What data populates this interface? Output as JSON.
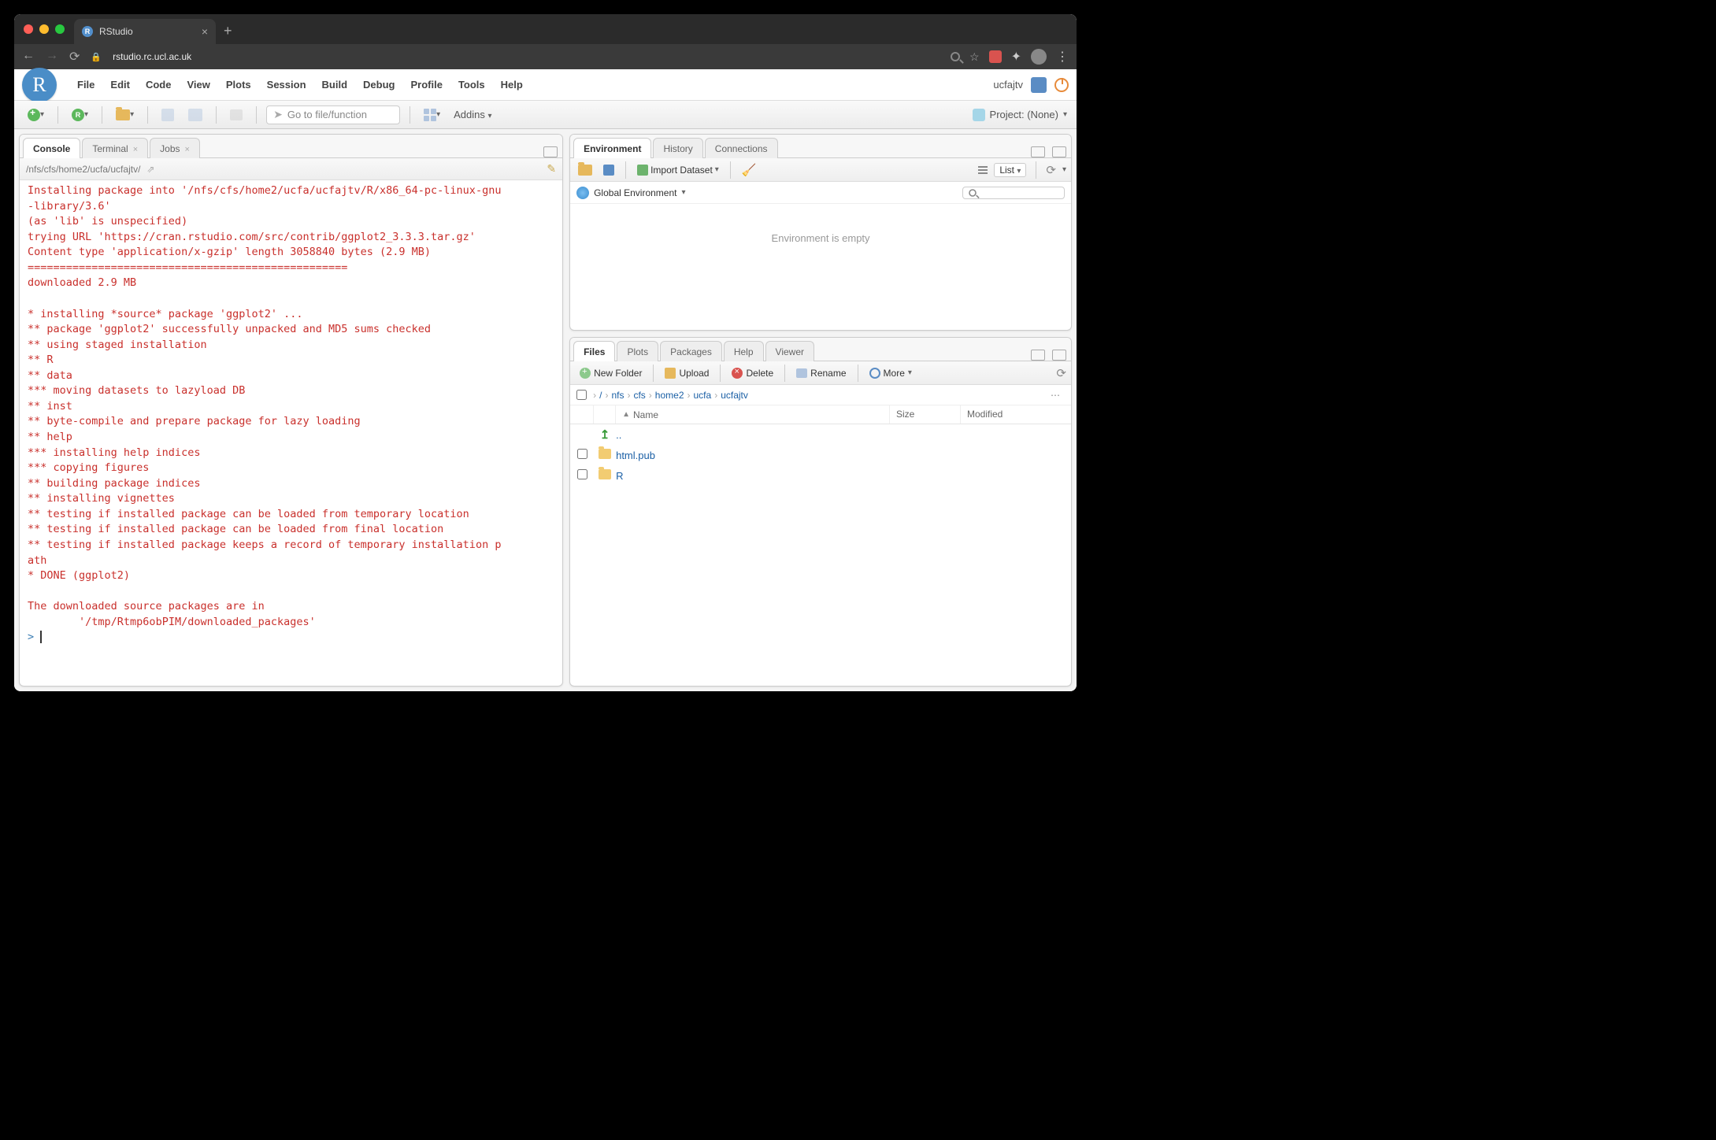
{
  "browser": {
    "tab_title": "RStudio",
    "url_host": "rstudio.rc.ucl.ac.uk"
  },
  "app": {
    "menus": [
      "File",
      "Edit",
      "Code",
      "View",
      "Plots",
      "Session",
      "Build",
      "Debug",
      "Profile",
      "Tools",
      "Help"
    ],
    "username": "ucfajtv",
    "goto_placeholder": "Go to file/function",
    "addins_label": "Addins",
    "project_label": "Project: (None)"
  },
  "left": {
    "tabs": [
      {
        "label": "Console",
        "closable": false
      },
      {
        "label": "Terminal",
        "closable": true
      },
      {
        "label": "Jobs",
        "closable": true
      }
    ],
    "working_dir": "/nfs/cfs/home2/ucfa/ucfajtv/",
    "console_lines": [
      "Installing package into '/nfs/cfs/home2/ucfa/ucfajtv/R/x86_64-pc-linux-gnu",
      "-library/3.6'",
      "(as 'lib' is unspecified)",
      "trying URL 'https://cran.rstudio.com/src/contrib/ggplot2_3.3.3.tar.gz'",
      "Content type 'application/x-gzip' length 3058840 bytes (2.9 MB)",
      "==================================================",
      "downloaded 2.9 MB",
      "",
      "* installing *source* package 'ggplot2' ...",
      "** package 'ggplot2' successfully unpacked and MD5 sums checked",
      "** using staged installation",
      "** R",
      "** data",
      "*** moving datasets to lazyload DB",
      "** inst",
      "** byte-compile and prepare package for lazy loading",
      "** help",
      "*** installing help indices",
      "*** copying figures",
      "** building package indices",
      "** installing vignettes",
      "** testing if installed package can be loaded from temporary location",
      "** testing if installed package can be loaded from final location",
      "** testing if installed package keeps a record of temporary installation p",
      "ath",
      "* DONE (ggplot2)",
      "",
      "The downloaded source packages are in",
      "        '/tmp/Rtmp6obPIM/downloaded_packages'"
    ],
    "prompt": ">"
  },
  "env": {
    "tabs": [
      "Environment",
      "History",
      "Connections"
    ],
    "import_label": "Import Dataset",
    "list_label": "List",
    "scope_label": "Global Environment",
    "empty_text": "Environment is empty"
  },
  "files": {
    "tabs": [
      "Files",
      "Plots",
      "Packages",
      "Help",
      "Viewer"
    ],
    "toolbar": {
      "new_folder": "New Folder",
      "upload": "Upload",
      "delete": "Delete",
      "rename": "Rename",
      "more": "More"
    },
    "breadcrumb": [
      "/",
      "nfs",
      "cfs",
      "home2",
      "ucfa",
      "ucfajtv"
    ],
    "columns": {
      "name": "Name",
      "size": "Size",
      "modified": "Modified"
    },
    "up_label": "..",
    "entries": [
      {
        "name": "html.pub",
        "type": "folder"
      },
      {
        "name": "R",
        "type": "folder"
      }
    ]
  }
}
